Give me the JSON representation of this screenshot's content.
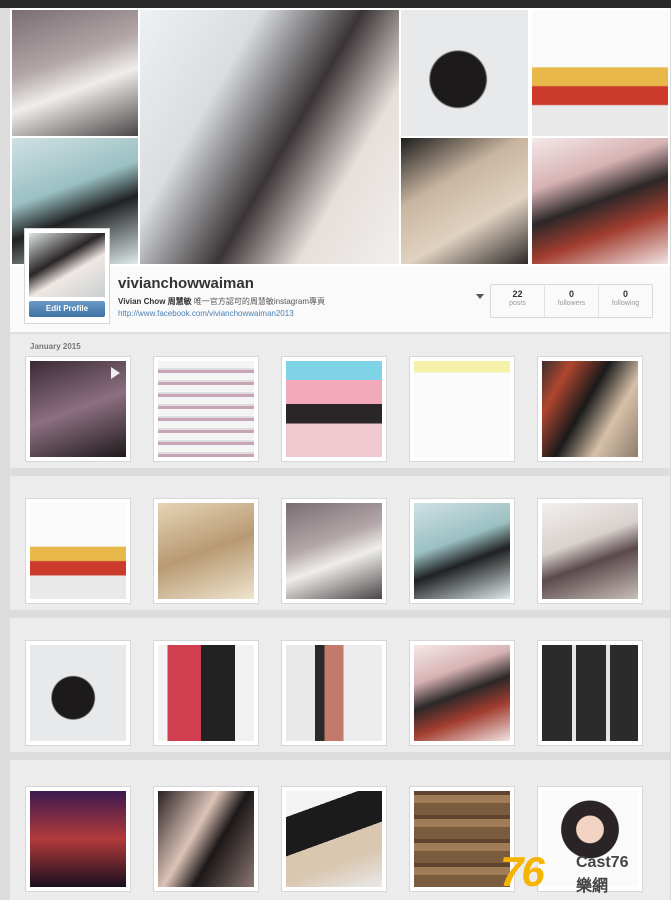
{
  "profile": {
    "username": "vivianchowwaiman",
    "full_name": "Vivian Chow 周慧敏",
    "bio": "唯一官方認可的周慧敏instagram專頁",
    "website": "http://www.facebook.com/vivianchowwaiman2013",
    "edit_label": "Edit Profile"
  },
  "stats": [
    {
      "value": "22",
      "label": "posts"
    },
    {
      "value": "0",
      "label": "followers"
    },
    {
      "value": "0",
      "label": "following"
    }
  ],
  "feed": {
    "date_header": "January 2015"
  },
  "watermark": {
    "number": "76",
    "text_top": "Cast76",
    "text_bottom": "樂網"
  }
}
